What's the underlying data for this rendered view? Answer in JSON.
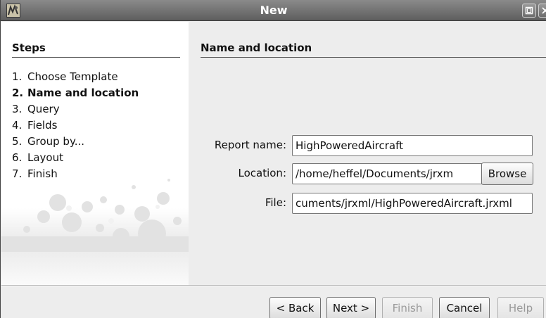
{
  "window": {
    "title": "New"
  },
  "steps": {
    "heading": "Steps",
    "items": [
      {
        "num": "1.",
        "label": "Choose Template"
      },
      {
        "num": "2.",
        "label": "Name and location"
      },
      {
        "num": "3.",
        "label": "Query"
      },
      {
        "num": "4.",
        "label": "Fields"
      },
      {
        "num": "5.",
        "label": "Group by..."
      },
      {
        "num": "6.",
        "label": "Layout"
      },
      {
        "num": "7.",
        "label": "Finish"
      }
    ],
    "current_index": 1
  },
  "panel": {
    "heading": "Name and location",
    "report_name": {
      "label": "Report name:",
      "value": "HighPoweredAircraft"
    },
    "location": {
      "label": "Location:",
      "value": "/home/heffel/Documents/jrxm"
    },
    "file": {
      "label": "File:",
      "value": "cuments/jrxml/HighPoweredAircraft.jrxml"
    },
    "browse_label": "Browse"
  },
  "buttons": {
    "back": "< Back",
    "next": "Next >",
    "finish": "Finish",
    "cancel": "Cancel",
    "help": "Help"
  },
  "icons": {
    "app": "app-icon",
    "maximize": "maximize-icon",
    "close": "close-icon"
  },
  "colors": {
    "titlebar": "#6e6e6e",
    "panel_bg": "#ededed",
    "disabled_text": "#9a9a9a"
  }
}
